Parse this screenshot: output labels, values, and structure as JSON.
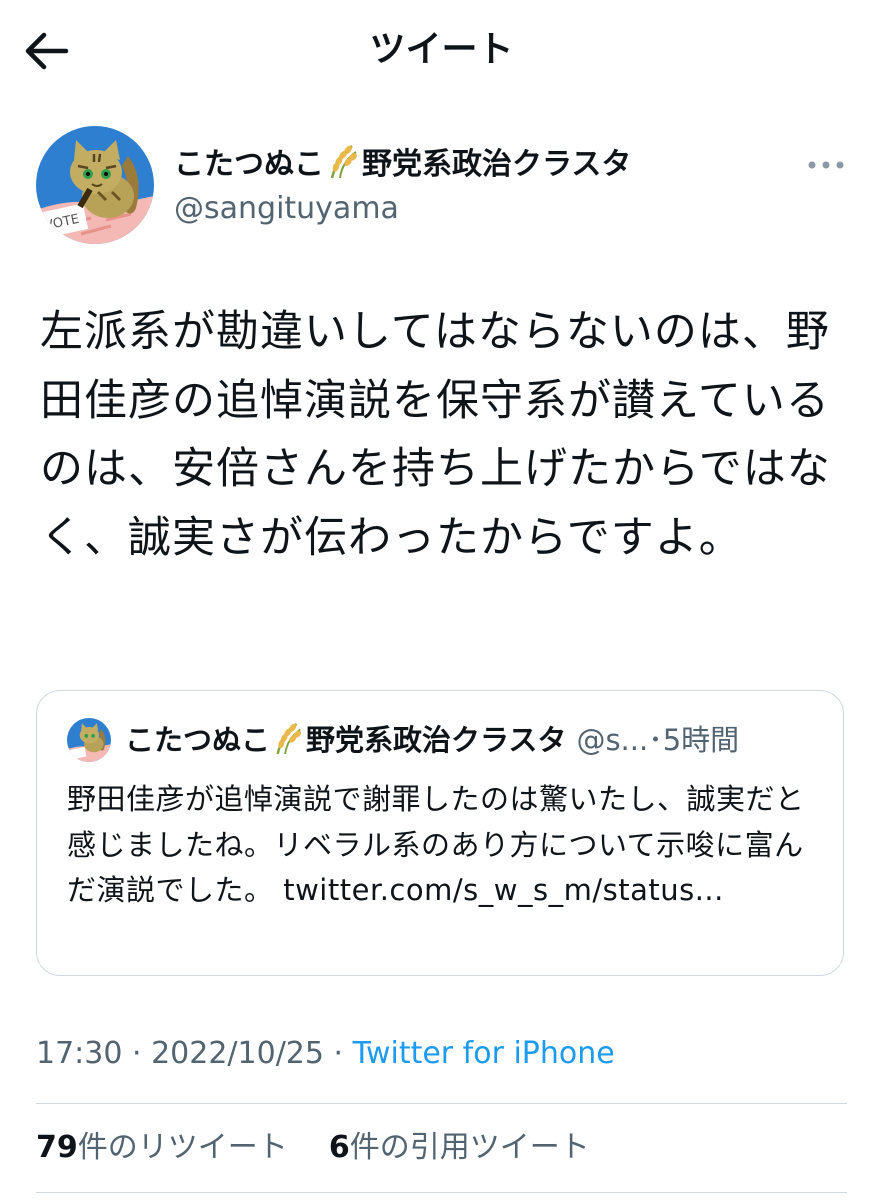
{
  "header": {
    "title": "ツイート",
    "back_icon": "arrow-left-icon"
  },
  "tweet": {
    "author": {
      "name_part1": "こたつぬこ",
      "name_emoji": "rice-plant-icon",
      "name_part2": "野党系政治クラスタ",
      "handle": "@sangituyama",
      "avatar_icon": "cat-avatar-icon",
      "avatar_text": "VOTE"
    },
    "more_icon": "more-dots-icon",
    "text": "左派系が勘違いしてはならないのは、野田佳彦の追悼演説を保守系が讃えているのは、安倍さんを持ち上げたからではなく、誠実さが伝わったからですよ。",
    "quote": {
      "name_part1": "こたつぬこ",
      "name_part2": "野党系政治クラスタ",
      "meta": "@s...･5時間",
      "text": "野田佳彦が追悼演説で謝罪したのは驚いたし、誠実だと感じましたね。リベラル系のあり方について示唆に富んだ演説でした。 twitter.com/s_w_s_m/status..."
    },
    "timestamp": "17:30 · 2022/10/25 · ",
    "source": "Twitter for iPhone",
    "stats": {
      "retweets_count": "79",
      "retweets_label": "件のリツイート",
      "quotes_count": "6",
      "quotes_label": "件の引用ツイート"
    }
  },
  "colors": {
    "text": "#0f1419",
    "secondary": "#536471",
    "link": "#1d9bf0",
    "border": "#cfd9de"
  }
}
